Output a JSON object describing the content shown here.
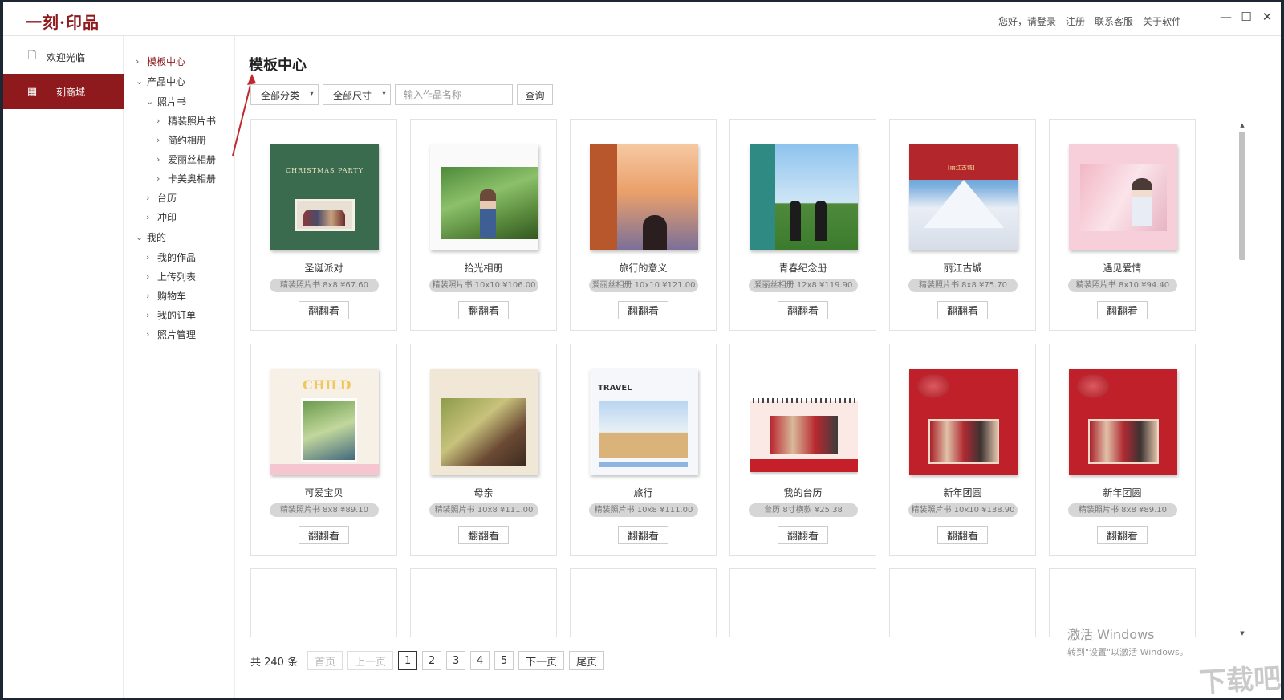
{
  "app": {
    "logo": "一刻·印品",
    "top_links": [
      "您好，请登录",
      "注册",
      "联系客服",
      "关于软件"
    ]
  },
  "leftnav": {
    "welcome": "欢迎光临",
    "mall": "一刻商城"
  },
  "tree": {
    "template_center": "模板中心",
    "product_center": "产品中心",
    "photo_book": "照片书",
    "deluxe_book": "精装照片书",
    "simple_album": "简约相册",
    "aili_album": "爱丽丝相册",
    "kamei_album": "卡美奥相册",
    "calendar": "台历",
    "print": "冲印",
    "mine": "我的",
    "my_works": "我的作品",
    "upload_list": "上传列表",
    "cart": "购物车",
    "my_orders": "我的订单",
    "photo_manage": "照片管理"
  },
  "main": {
    "title": "模板中心",
    "filters": {
      "category": "全部分类",
      "size": "全部尺寸",
      "search_placeholder": "输入作品名称",
      "query": "查询"
    },
    "button_label": "翻翻看",
    "cards": [
      {
        "name": "圣诞派对",
        "price": "精装照片书 8x8 ¥67.60",
        "cover_text": "CHRISTMAS PARTY"
      },
      {
        "name": "拾光相册",
        "price": "精装照片书 10x10 ¥106.00"
      },
      {
        "name": "旅行的意义",
        "price": "爱丽丝相册 10x10 ¥121.00"
      },
      {
        "name": "青春纪念册",
        "price": "爱丽丝相册 12x8 ¥119.90"
      },
      {
        "name": "丽江古城",
        "price": "精装照片书 8x8 ¥75.70"
      },
      {
        "name": "遇见爱情",
        "price": "精装照片书 8x10 ¥94.40"
      },
      {
        "name": "可爱宝贝",
        "price": "精装照片书 8x8 ¥89.10",
        "cover_text": "CHILD"
      },
      {
        "name": "母亲",
        "price": "精装照片书 10x8 ¥111.00"
      },
      {
        "name": "旅行",
        "price": "精装照片书 10x8 ¥111.00",
        "cover_text": "TRAVEL"
      },
      {
        "name": "我的台历",
        "price": "台历 8寸横款 ¥25.38"
      },
      {
        "name": "新年团圆",
        "price": "精装照片书 10x10 ¥138.90"
      },
      {
        "name": "新年团圆",
        "price": "精装照片书 8x8 ¥89.10"
      }
    ]
  },
  "pager": {
    "total": "共 240 条",
    "first": "首页",
    "prev": "上一页",
    "pages": [
      "1",
      "2",
      "3",
      "4",
      "5"
    ],
    "current": "1",
    "next": "下一页",
    "last": "尾页"
  },
  "watermark": {
    "title": "激活 Windows",
    "subtitle": "转到\"设置\"以激活 Windows。",
    "brand": "下载吧"
  },
  "colors": {
    "brand": "#8e1a1e"
  }
}
